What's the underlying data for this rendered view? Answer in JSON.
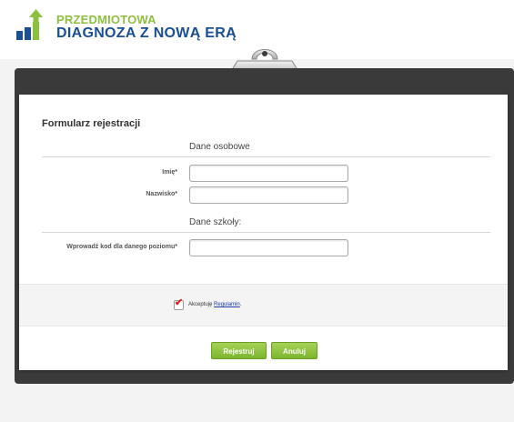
{
  "header": {
    "logo_line1": "PRZEDMIOTOWA",
    "logo_line2": "DIAGNOZA Z NOWĄ ERĄ"
  },
  "form": {
    "title": "Formularz rejestracji",
    "personal_section": "Dane osobowe",
    "first_name_label": "Imię*",
    "first_name_value": "",
    "last_name_label": "Nazwisko*",
    "last_name_value": "",
    "school_section": "Dane szkoły:",
    "code_label": "Wprowadź kod dla danego poziomu*",
    "code_value": "",
    "terms_prefix": "Akceptuję",
    "terms_link": "Regulamin",
    "terms_suffix": ".",
    "terms_checked": true,
    "register_label": "Rejestruj",
    "cancel_label": "Anuluj"
  },
  "colors": {
    "logo_green": "#8dc03f",
    "logo_blue": "#1b4f93",
    "button_green": "#8cc63f",
    "clipboard": "#3a3a3a",
    "check_red": "#d42020"
  }
}
